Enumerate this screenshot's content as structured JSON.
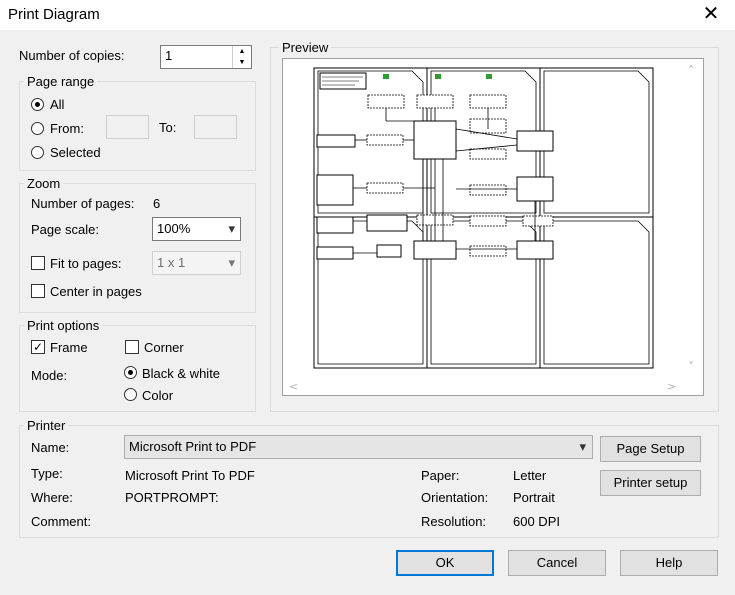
{
  "window": {
    "title": "Print Diagram",
    "close_glyph": "✕"
  },
  "copies": {
    "label": "Number of copies:",
    "value": "1"
  },
  "page_range": {
    "label": "Page range",
    "all_label": "All",
    "from_label": "From:",
    "to_label": "To:",
    "selected_label": "Selected",
    "from_value": "",
    "to_value": ""
  },
  "zoom": {
    "label": "Zoom",
    "num_pages_label": "Number of pages:",
    "num_pages_value": "6",
    "page_scale_label": "Page scale:",
    "page_scale_value": "100%",
    "fit_label": "Fit to pages:",
    "fit_value": "1 x 1",
    "center_label": "Center in pages"
  },
  "print_options": {
    "label": "Print options",
    "frame_label": "Frame",
    "corner_label": "Corner",
    "mode_label": "Mode:",
    "bw_label": "Black & white",
    "color_label": "Color"
  },
  "preview": {
    "label": "Preview"
  },
  "printer": {
    "label": "Printer",
    "name_label": "Name:",
    "name_value": "Microsoft Print to PDF",
    "type_label": "Type:",
    "type_value": "Microsoft Print To PDF",
    "where_label": "Where:",
    "where_value": "PORTPROMPT:",
    "comment_label": "Comment:",
    "paper_label": "Paper:",
    "paper_value": "Letter",
    "orientation_label": "Orientation:",
    "orientation_value": "Portrait",
    "resolution_label": "Resolution:",
    "resolution_value": "600 DPI",
    "page_setup_label": "Page Setup",
    "printer_setup_label": "Printer setup"
  },
  "buttons": {
    "ok": "OK",
    "cancel": "Cancel",
    "help": "Help"
  },
  "icons": {
    "spin_up": "▲",
    "spin_down": "▼",
    "dropdown": "▾",
    "check": "✓",
    "scroll_up": "˄",
    "scroll_down": "˅",
    "scroll_left": "<",
    "scroll_right": ">"
  }
}
